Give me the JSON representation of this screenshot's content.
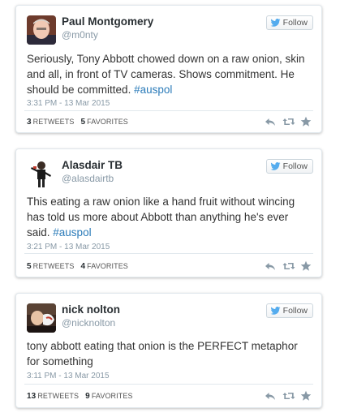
{
  "tweets": [
    {
      "name": "Paul Montgomery",
      "handle": "@m0nty",
      "follow_label": "Follow",
      "text_before": "Seriously, Tony Abbott chowed down on a raw onion, skin and all, in front of TV cameras. Shows commitment. He should be committed. ",
      "hashtag": "#auspol",
      "time": "3:31 PM - 13 Mar 2015",
      "retweets": "3",
      "retweets_label": "RETWEETS",
      "favorites": "5",
      "favorites_label": "FAVORITES"
    },
    {
      "name": "Alasdair TB",
      "handle": "@alasdairtb",
      "follow_label": "Follow",
      "text_before": "This eating a raw onion like a hand fruit without wincing has told us more about Abbott than anything he's ever said. ",
      "hashtag": "#auspol",
      "time": "3:21 PM - 13 Mar 2015",
      "retweets": "5",
      "retweets_label": "RETWEETS",
      "favorites": "4",
      "favorites_label": "FAVORITES"
    },
    {
      "name": "nick nolton",
      "handle": "@nicknolton",
      "follow_label": "Follow",
      "text_before": "tony abbott eating that onion is the PERFECT metaphor for something",
      "hashtag": "",
      "time": "3:11 PM - 13 Mar 2015",
      "retweets": "13",
      "retweets_label": "RETWEETS",
      "favorites": "9",
      "favorites_label": "FAVORITES"
    }
  ],
  "icons": {
    "follow": "twitter-bird-icon",
    "reply": "reply-icon",
    "retweet": "retweet-icon",
    "favorite": "star-icon"
  },
  "colors": {
    "link": "#2b7bb9",
    "bird": "#55acee",
    "action_icon": "#8899a6"
  }
}
